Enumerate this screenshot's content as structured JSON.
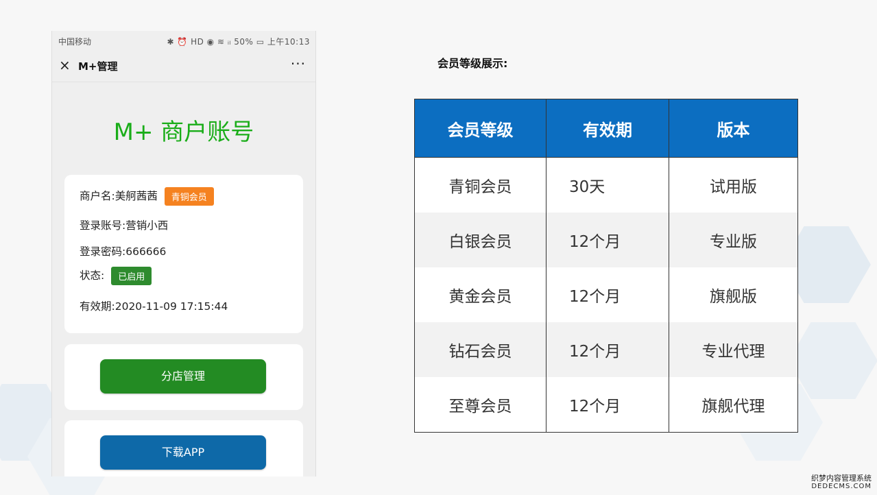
{
  "status_bar": {
    "carrier": "中国移动",
    "indicators": "✱ ⏰ HD ◉ ≋ ᵢₗ 50% ▭ 上午10:13"
  },
  "nav": {
    "close_icon": "×",
    "title": "M+管理",
    "more_icon": "···"
  },
  "page_title": "M+ 商户账号",
  "merchant": {
    "name_label": "商户名:美舸茜茜",
    "level_badge": "青铜会员",
    "account_label": "登录账号:营销小西",
    "password_label": "登录密码:666666",
    "status_label": "状态:",
    "status_badge": "已启用",
    "expiry_label": "有效期:2020-11-09 17:15:44"
  },
  "buttons": {
    "branch_manage": "分店管理",
    "download_app": "下载APP"
  },
  "section_title": "会员等级展示:",
  "levels_table": {
    "headers": [
      "会员等级",
      "有效期",
      "版本"
    ],
    "rows": [
      [
        "青铜会员",
        "30天",
        "试用版"
      ],
      [
        "白银会员",
        "12个月",
        "专业版"
      ],
      [
        "黄金会员",
        "12个月",
        "旗舰版"
      ],
      [
        "钻石会员",
        "12个月",
        "专业代理"
      ],
      [
        "至尊会员",
        "12个月",
        "旗舰代理"
      ]
    ]
  },
  "watermark": {
    "line1": "织梦内容管理系统",
    "line2": "DEDECMS.COM"
  },
  "colors": {
    "brand_green": "#1aad19",
    "button_green": "#238b23",
    "button_blue": "#0e69a8",
    "badge_orange": "#f58220",
    "table_header_blue": "#0c6ec1"
  }
}
